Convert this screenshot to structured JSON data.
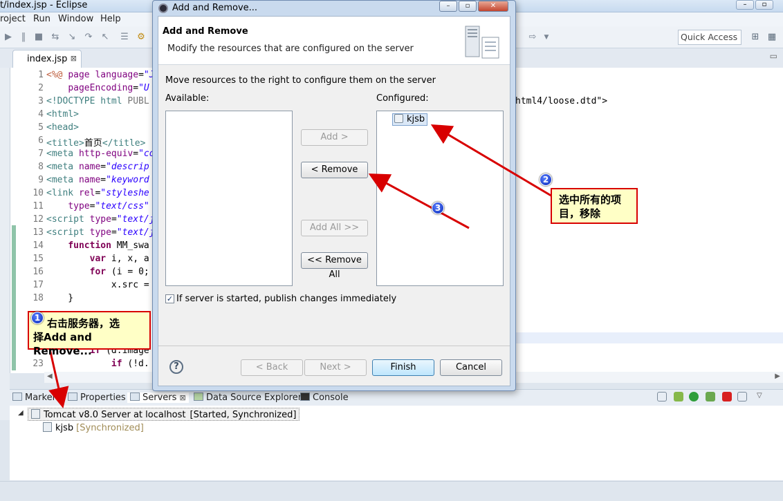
{
  "window": {
    "title": "t/index.jsp - Eclipse",
    "controls": [
      "minimize-icon",
      "maximize-icon",
      "close-icon"
    ]
  },
  "menu": [
    "roject",
    "Run",
    "Window",
    "Help"
  ],
  "toolbar": {
    "quick_access": "Quick Access"
  },
  "editor": {
    "tab_label": "index.jsp",
    "tab_close": "⊠",
    "line_numbers": [
      "1",
      "2",
      "3",
      "4",
      "5",
      "6",
      "7",
      "8",
      "9",
      "10",
      "11",
      "12",
      "13",
      "14",
      "15",
      "16",
      "17",
      "18",
      "",
      "",
      "",
      "",
      "23"
    ],
    "doctype_tail": "html4/loose.dtd\">"
  },
  "panel": {
    "tabs": [
      "Marker",
      "Properties",
      "Servers",
      "Data Source Explorer",
      "Console"
    ],
    "server_name": "Tomcat v8.0 Server at localhost",
    "server_status": "[Started, Synchronized]",
    "module_name": "kjsb",
    "module_status": "[Synchronized]"
  },
  "dialog": {
    "window_title": "Add and Remove...",
    "heading": "Add and Remove",
    "description": "Modify the resources that are configured on the server",
    "instructions": "Move resources to the right to configure them on the server",
    "available_label": "Available:",
    "configured_label": "Configured:",
    "configured_items": [
      "kjsb"
    ],
    "buttons": {
      "add": "Add >",
      "remove": "< Remove",
      "add_all": "Add All >>",
      "remove_all": "<< Remove All",
      "back": "< Back",
      "next": "Next >",
      "finish": "Finish",
      "cancel": "Cancel"
    },
    "publish_checkbox_label": "If server is started, publish changes immediately",
    "publish_checked": true,
    "help": "?"
  },
  "annotations": [
    {
      "number": "1",
      "text_line1": "右击服务器，选",
      "text_line2": "择Add and Remove..."
    },
    {
      "number": "2",
      "text_line1": "选中所有的项",
      "text_line2": "目，移除"
    },
    {
      "number": "3"
    }
  ],
  "colors": {
    "annotation_red": "#d80000",
    "callout_fill": "#ffffc6",
    "badge_blue": "#1a3fd0",
    "keyword": "#7f0055",
    "string": "#2a00ff"
  }
}
